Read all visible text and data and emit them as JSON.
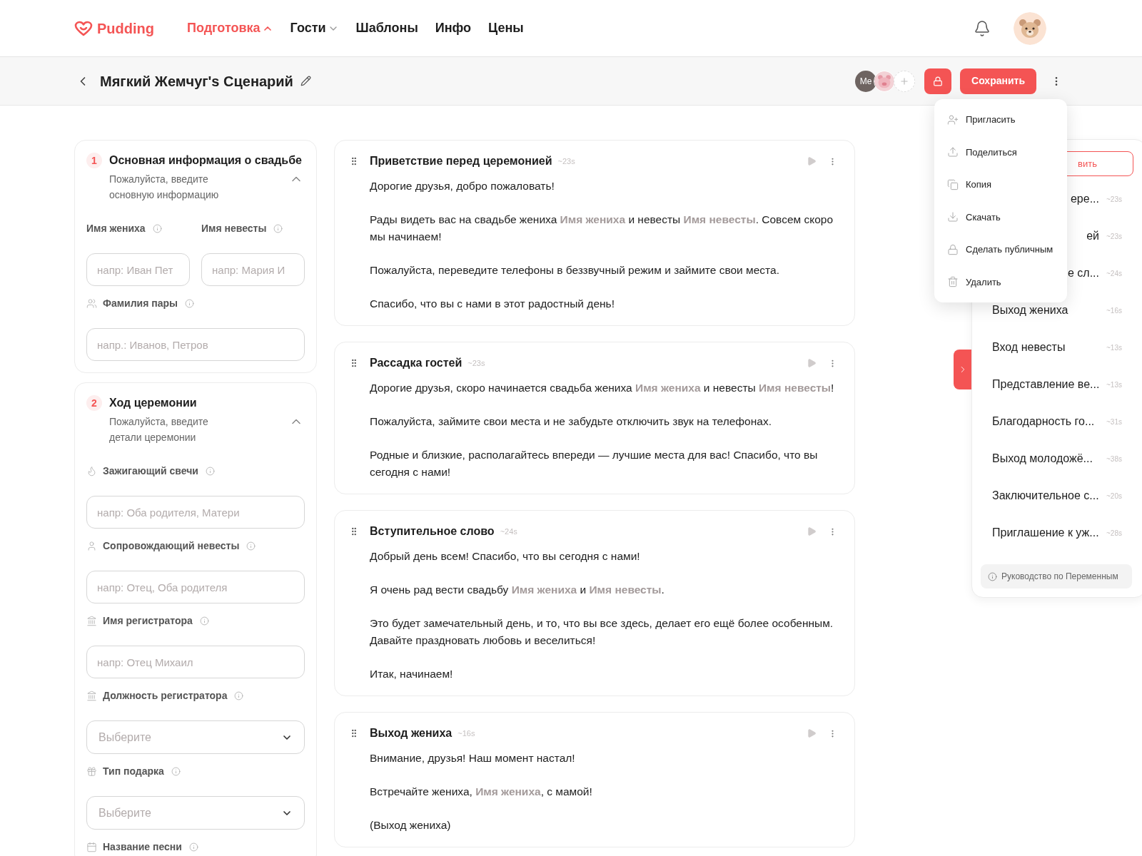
{
  "brand": "Pudding",
  "nav": [
    {
      "label": "Подготовка",
      "selected": true,
      "kind": "menu",
      "expanded": true
    },
    {
      "label": "Гости",
      "selected": false,
      "kind": "menu",
      "expanded": false
    },
    {
      "label": "Шаблоны",
      "selected": false,
      "kind": "link"
    },
    {
      "label": "Инфо",
      "selected": false,
      "kind": "link"
    },
    {
      "label": "Цены",
      "selected": false,
      "kind": "link"
    }
  ],
  "toolbar": {
    "title": "Мягкий Жемчуг's Сценарий",
    "collaborators": [
      {
        "kind": "initials",
        "text": "Me"
      },
      {
        "kind": "avatar"
      }
    ],
    "save": "Сохранить"
  },
  "menu": [
    {
      "label": "Пригласить"
    },
    {
      "label": "Поделиться"
    },
    {
      "label": "Копия"
    },
    {
      "label": "Скачать"
    },
    {
      "label": "Сделать публичным"
    },
    {
      "label": "Удалить"
    }
  ],
  "sections": [
    {
      "number": "1",
      "title": "Основная информация о свадьбе",
      "subtitle": "Пожалуйста, введите основную информацию",
      "expanded": true,
      "fields": [
        {
          "kind": "pair",
          "fields": [
            {
              "label": "Имя жениха",
              "control": {
                "kind": "input",
                "placeholder": "напр: Иван Пет"
              }
            },
            {
              "label": "Имя невесты",
              "control": {
                "kind": "input",
                "placeholder": "напр: Мария И"
              }
            }
          ]
        },
        {
          "kind": "single",
          "label": "Фамилия пары",
          "control": {
            "kind": "input",
            "placeholder": "напр.: Иванов, Петров"
          }
        }
      ]
    },
    {
      "number": "2",
      "title": "Ход церемонии",
      "subtitle": "Пожалуйста, введите детали церемонии",
      "expanded": true,
      "fields": [
        {
          "kind": "single",
          "label": "Зажигающий свечи",
          "control": {
            "kind": "input",
            "placeholder": "напр: Оба родителя, Матери"
          }
        },
        {
          "kind": "single",
          "label": "Сопровождающий невесты",
          "control": {
            "kind": "input",
            "placeholder": "напр: Отец, Оба родителя"
          }
        },
        {
          "kind": "single",
          "label": "Имя регистратора",
          "control": {
            "kind": "input",
            "placeholder": "напр: Отец Михаил"
          }
        },
        {
          "kind": "single",
          "label": "Должность регистратора",
          "control": {
            "kind": "select",
            "placeholder": "Выберите"
          }
        },
        {
          "kind": "single",
          "label": "Тип подарка",
          "control": {
            "kind": "select",
            "placeholder": "Выберите"
          }
        },
        {
          "kind": "single",
          "label": "Название песни"
        }
      ]
    }
  ],
  "scripts": [
    {
      "title": "Приветствие перед церемонией",
      "duration": "~23s",
      "paragraphs": [
        [
          {
            "kind": "text",
            "text": "Дорогие друзья, добро пожаловать!"
          }
        ],
        [
          {
            "kind": "text",
            "text": "Рады видеть вас на свадьбе жениха "
          },
          {
            "kind": "variable",
            "text": "Имя жениха"
          },
          {
            "kind": "text",
            "text": " и невесты "
          },
          {
            "kind": "variable",
            "text": "Имя невесты"
          },
          {
            "kind": "text",
            "text": ". Совсем скоро мы начинаем!"
          }
        ],
        [
          {
            "kind": "text",
            "text": "Пожалуйста, переведите телефоны в беззвучный режим и займите свои места."
          }
        ],
        [
          {
            "kind": "text",
            "text": "Спасибо, что вы с нами в этот радостный день!"
          }
        ]
      ]
    },
    {
      "title": "Рассадка гостей",
      "duration": "~23s",
      "paragraphs": [
        [
          {
            "kind": "text",
            "text": "Дорогие друзья, скоро начинается свадьба жениха "
          },
          {
            "kind": "variable",
            "text": "Имя жениха"
          },
          {
            "kind": "text",
            "text": " и невесты "
          },
          {
            "kind": "variable",
            "text": "Имя невесты"
          },
          {
            "kind": "text",
            "text": "!"
          }
        ],
        [
          {
            "kind": "text",
            "text": "Пожалуйста, займите свои места и не забудьте отключить звук на телефонах."
          }
        ],
        [
          {
            "kind": "text",
            "text": "Родные и близкие, располагайтесь впереди — лучшие места для вас! Спасибо, что вы сегодня с нами!"
          }
        ]
      ]
    },
    {
      "title": "Вступительное слово",
      "duration": "~24s",
      "paragraphs": [
        [
          {
            "kind": "text",
            "text": "Добрый день всем! Спасибо, что вы сегодня с нами!"
          }
        ],
        [
          {
            "kind": "text",
            "text": "Я очень рад вести свадьбу "
          },
          {
            "kind": "variable",
            "text": "Имя жениха"
          },
          {
            "kind": "text",
            "text": " и "
          },
          {
            "kind": "variable",
            "text": "Имя невесты"
          },
          {
            "kind": "text",
            "text": "."
          }
        ],
        [
          {
            "kind": "text",
            "text": "Это будет замечательный день, и то, что вы все здесь, делает его ещё более особенным. Давайте праздновать любовь и веселиться!"
          }
        ],
        [
          {
            "kind": "text",
            "text": "Итак, начинаем!"
          }
        ]
      ]
    },
    {
      "title": "Выход жениха",
      "duration": "~16s",
      "paragraphs": [
        [
          {
            "kind": "text",
            "text": "Внимание, друзья! Наш момент настал!"
          }
        ],
        [
          {
            "kind": "text",
            "text": "Встречайте жениха, "
          },
          {
            "kind": "variable",
            "text": "Имя жениха"
          },
          {
            "kind": "text",
            "text": ", с мамой!"
          }
        ],
        [
          {
            "kind": "text",
            "text": "(Выход жениха)"
          }
        ]
      ]
    }
  ],
  "outline": {
    "add": "вить",
    "items": [
      {
        "title": "ере...",
        "duration": "~23s",
        "kind": "partial"
      },
      {
        "title": "ей",
        "duration": "~23s",
        "kind": "partial"
      },
      {
        "title": "е сл...",
        "duration": "~24s",
        "kind": "partial"
      },
      {
        "title": "Выход жениха",
        "duration": "~16s",
        "kind": "full"
      },
      {
        "title": "Вход невесты",
        "duration": "~13s",
        "kind": "full"
      },
      {
        "title": "Представление ве...",
        "duration": "~13s",
        "kind": "full"
      },
      {
        "title": "Благодарность го...",
        "duration": "~31s",
        "kind": "full"
      },
      {
        "title": "Выход молодожё...",
        "duration": "~38s",
        "kind": "full"
      },
      {
        "title": "Заключительное с...",
        "duration": "~20s",
        "kind": "full"
      },
      {
        "title": "Приглашение к уж...",
        "duration": "~28s",
        "kind": "full"
      }
    ],
    "guide": "Руководство по Переменным"
  }
}
